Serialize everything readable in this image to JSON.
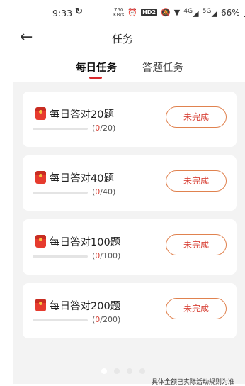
{
  "status_bar": {
    "time": "9:33",
    "sync_glyph": "↻",
    "speed_top": "750",
    "speed_bottom": "KB/s",
    "hd": "HD2",
    "signal_a": "4G",
    "signal_b": "5G",
    "battery": "66%"
  },
  "header": {
    "title": "任务"
  },
  "tabs": [
    {
      "label": "每日任务"
    },
    {
      "label": "答题任务"
    }
  ],
  "tasks": [
    {
      "title": "每日答对20题",
      "current": "0",
      "total": "/20",
      "progress": 0,
      "status": "未完成"
    },
    {
      "title": "每日答对40题",
      "current": "0",
      "total": "/40",
      "progress": 0,
      "status": "未完成"
    },
    {
      "title": "每日答对100题",
      "current": "0",
      "total": "/100",
      "progress": 0,
      "status": "未完成"
    },
    {
      "title": "每日答对200题",
      "current": "0",
      "total": "/200",
      "progress": 0,
      "status": "未完成"
    }
  ],
  "footer": {
    "note": "具体金额已实际活动规则为准"
  }
}
